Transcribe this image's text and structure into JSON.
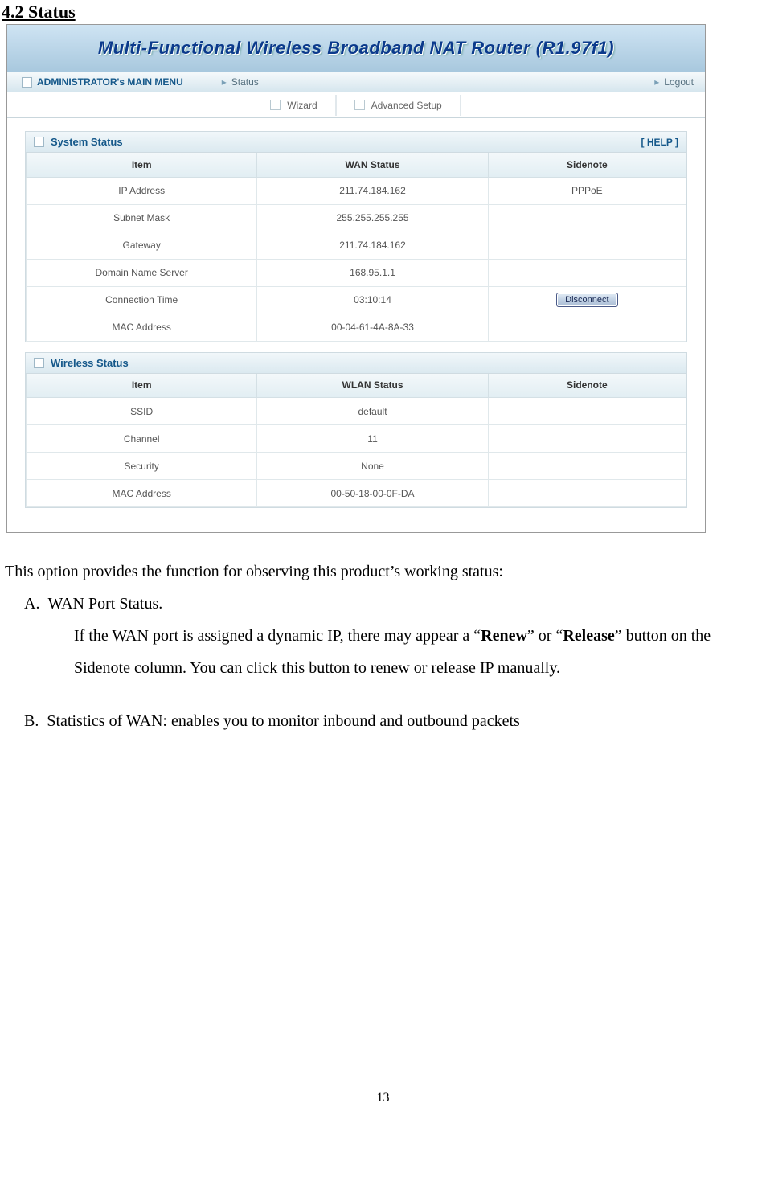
{
  "doc": {
    "section_number": "4.2 Status",
    "intro": "This option provides the function for observing this product’s working status:",
    "item_a_label": "A.",
    "item_a_title": "WAN Port Status.",
    "item_a_body_1": "If the WAN port is assigned a dynamic IP, there may appear a “",
    "item_a_body_2_bold": "Renew",
    "item_a_body_3": "” or “",
    "item_a_body_4_bold": "Release",
    "item_a_body_5": "” button on the Sidenote column. You can click this button to renew or release IP manually.",
    "item_b_label": "B.",
    "item_b_text": "Statistics of WAN: enables you to monitor inbound and outbound packets",
    "page_number": "13"
  },
  "router": {
    "banner_title": "Multi-Functional Wireless Broadband NAT Router (R1.97f1)",
    "menu": {
      "admin_label": "ADMINISTRATOR's MAIN MENU",
      "status_label": "Status",
      "logout_label": "Logout"
    },
    "tabs": {
      "wizard": "Wizard",
      "advanced": "Advanced Setup"
    },
    "system_panel": {
      "title": "System Status",
      "help": "[ HELP ]",
      "headers": {
        "c1": "Item",
        "c2": "WAN Status",
        "c3": "Sidenote"
      },
      "rows": [
        {
          "item": "IP Address",
          "value": "211.74.184.162",
          "side": "PPPoE"
        },
        {
          "item": "Subnet Mask",
          "value": "255.255.255.255",
          "side": ""
        },
        {
          "item": "Gateway",
          "value": "211.74.184.162",
          "side": ""
        },
        {
          "item": "Domain Name Server",
          "value": "168.95.1.1",
          "side": ""
        },
        {
          "item": "Connection Time",
          "value": "03:10:14",
          "side": "__BUTTON__"
        },
        {
          "item": "MAC Address",
          "value": "00-04-61-4A-8A-33",
          "side": ""
        }
      ],
      "disconnect_label": "Disconnect"
    },
    "wireless_panel": {
      "title": "Wireless Status",
      "headers": {
        "c1": "Item",
        "c2": "WLAN Status",
        "c3": "Sidenote"
      },
      "rows": [
        {
          "item": "SSID",
          "value": "default",
          "side": ""
        },
        {
          "item": "Channel",
          "value": "11",
          "side": ""
        },
        {
          "item": "Security",
          "value": "None",
          "side": ""
        },
        {
          "item": "MAC Address",
          "value": "00-50-18-00-0F-DA",
          "side": ""
        }
      ]
    }
  }
}
